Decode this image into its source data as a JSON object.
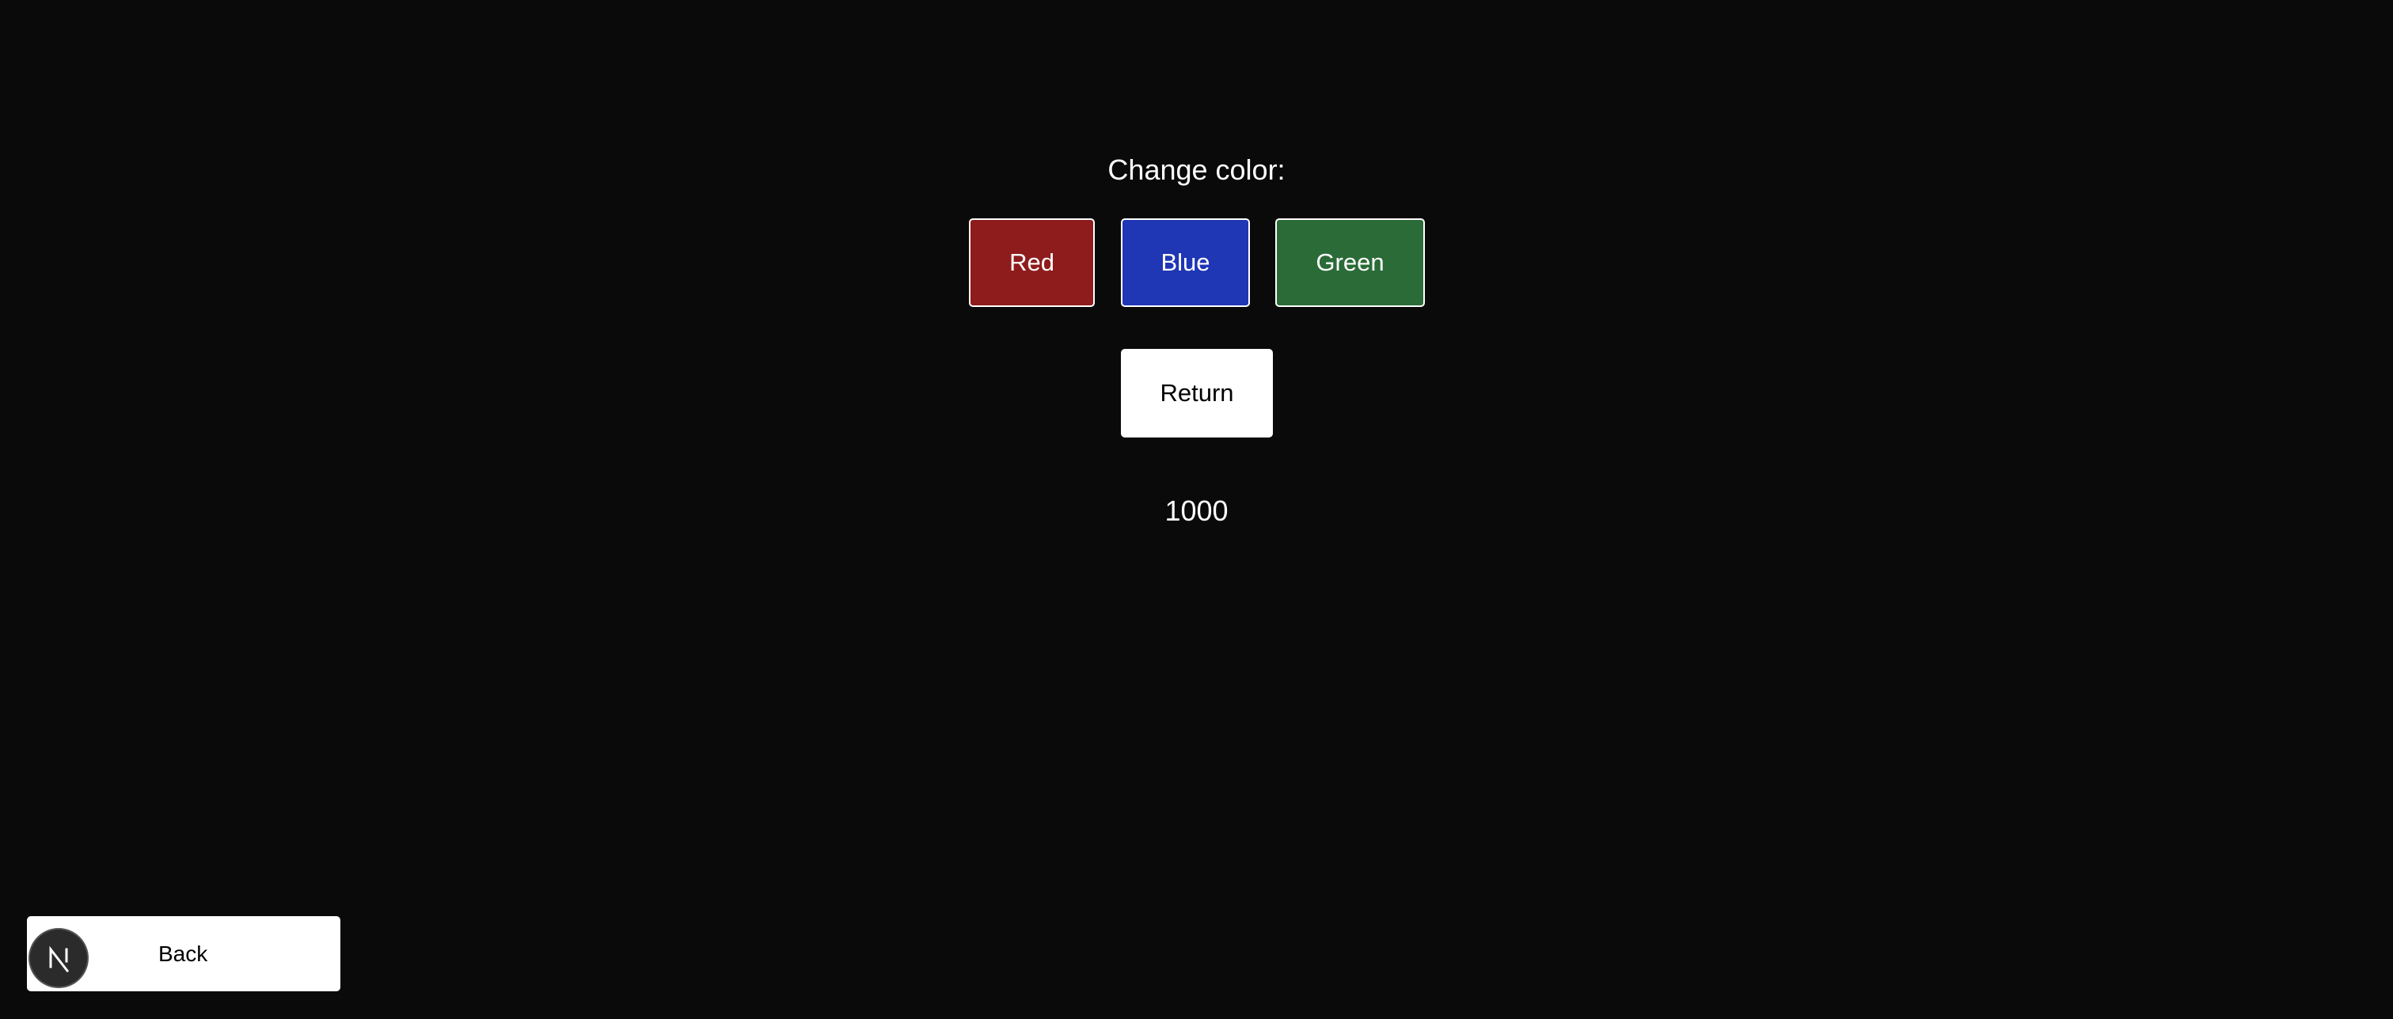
{
  "main": {
    "heading": "Change color:",
    "color_buttons": [
      {
        "label": "Red",
        "color": "#8f1c1c"
      },
      {
        "label": "Blue",
        "color": "#1f36b5"
      },
      {
        "label": "Green",
        "color": "#2a6b37"
      }
    ],
    "return_label": "Return",
    "counter_value": "1000"
  },
  "footer": {
    "back_label": "Back",
    "logo_icon": "next-logo-icon",
    "logo_bg": "#2b2b2b"
  },
  "colors": {
    "page_bg": "#0a0a0a",
    "text": "#ffffff"
  }
}
